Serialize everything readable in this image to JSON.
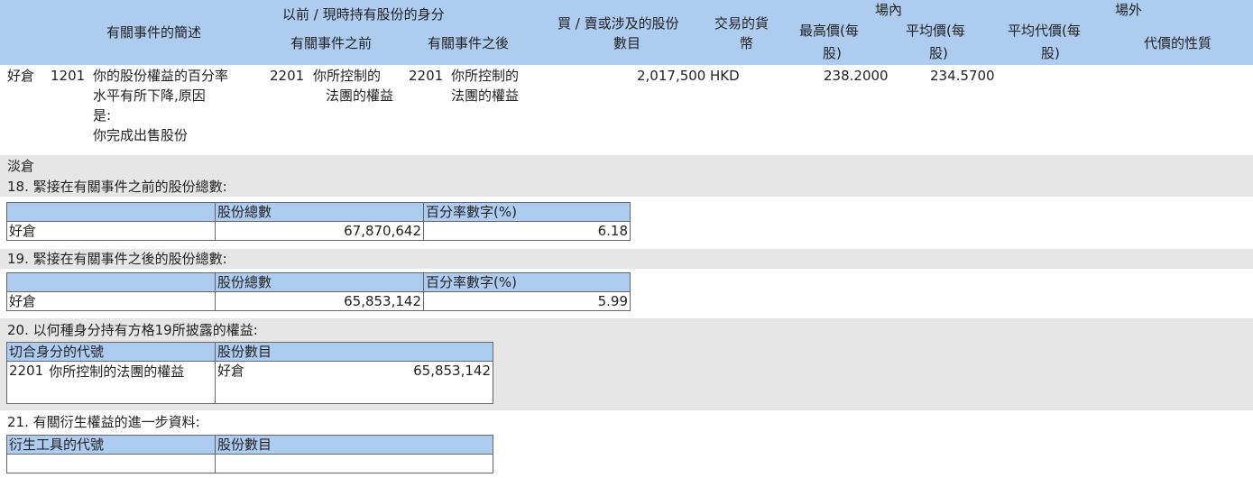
{
  "header": {
    "event_desc": "有關事件的簡述",
    "capacity_title": "以前 / 現時持有股份的身分",
    "before": "有關事件之前",
    "after": "有關事件之後",
    "shares_l1": "買 / 賣或涉及的股份",
    "shares_l2": "數目",
    "currency_l1": "交易的貨",
    "currency_l2": "幣",
    "on_exchange": "場內",
    "off_exchange": "場外",
    "highest_l1": "最高價(每",
    "highest_l2": "股)",
    "average_l1": "平均價(每",
    "average_l2": "股)",
    "avg_consideration_l1": "平均代價(每",
    "avg_consideration_l2": "股)",
    "consideration_nature": "代價的性質"
  },
  "row": {
    "position": "好倉",
    "event_code": "1201",
    "event_text": [
      "你的股份權益的百分率",
      "水平有所下降,原因",
      "是:",
      "你完成出售股份"
    ],
    "before_code": "2201",
    "before_text": [
      "你所控制的",
      "法團的權益"
    ],
    "after_code": "2201",
    "after_text": [
      "你所控制的",
      "法團的權益"
    ],
    "shares": "2,017,500",
    "currency": "HKD",
    "highest": "238.2000",
    "average": "234.5700"
  },
  "short_position": "淡倉",
  "s18": {
    "title": "18. 緊接在有關事件之前的股份總數:",
    "col_total": "股份總數",
    "col_pct": "百分率數字(%)",
    "position": "好倉",
    "total": "67,870,642",
    "pct": "6.18"
  },
  "s19": {
    "title": "19. 緊接在有關事件之後的股份總數:",
    "col_total": "股份總數",
    "col_pct": "百分率數字(%)",
    "position": "好倉",
    "total": "65,853,142",
    "pct": "5.99"
  },
  "s20": {
    "title": "20. 以何種身分持有方格19所披露的權益:",
    "col_code": "切合身分的代號",
    "col_shares": "股份數目",
    "code": "2201",
    "code_text": "你所控制的法團的權益",
    "position": "好倉",
    "shares": "65,853,142"
  },
  "s21": {
    "title": "21. 有關衍生權益的進一步資料:",
    "col_code": "衍生工具的代號",
    "col_shares": "股份數目"
  }
}
